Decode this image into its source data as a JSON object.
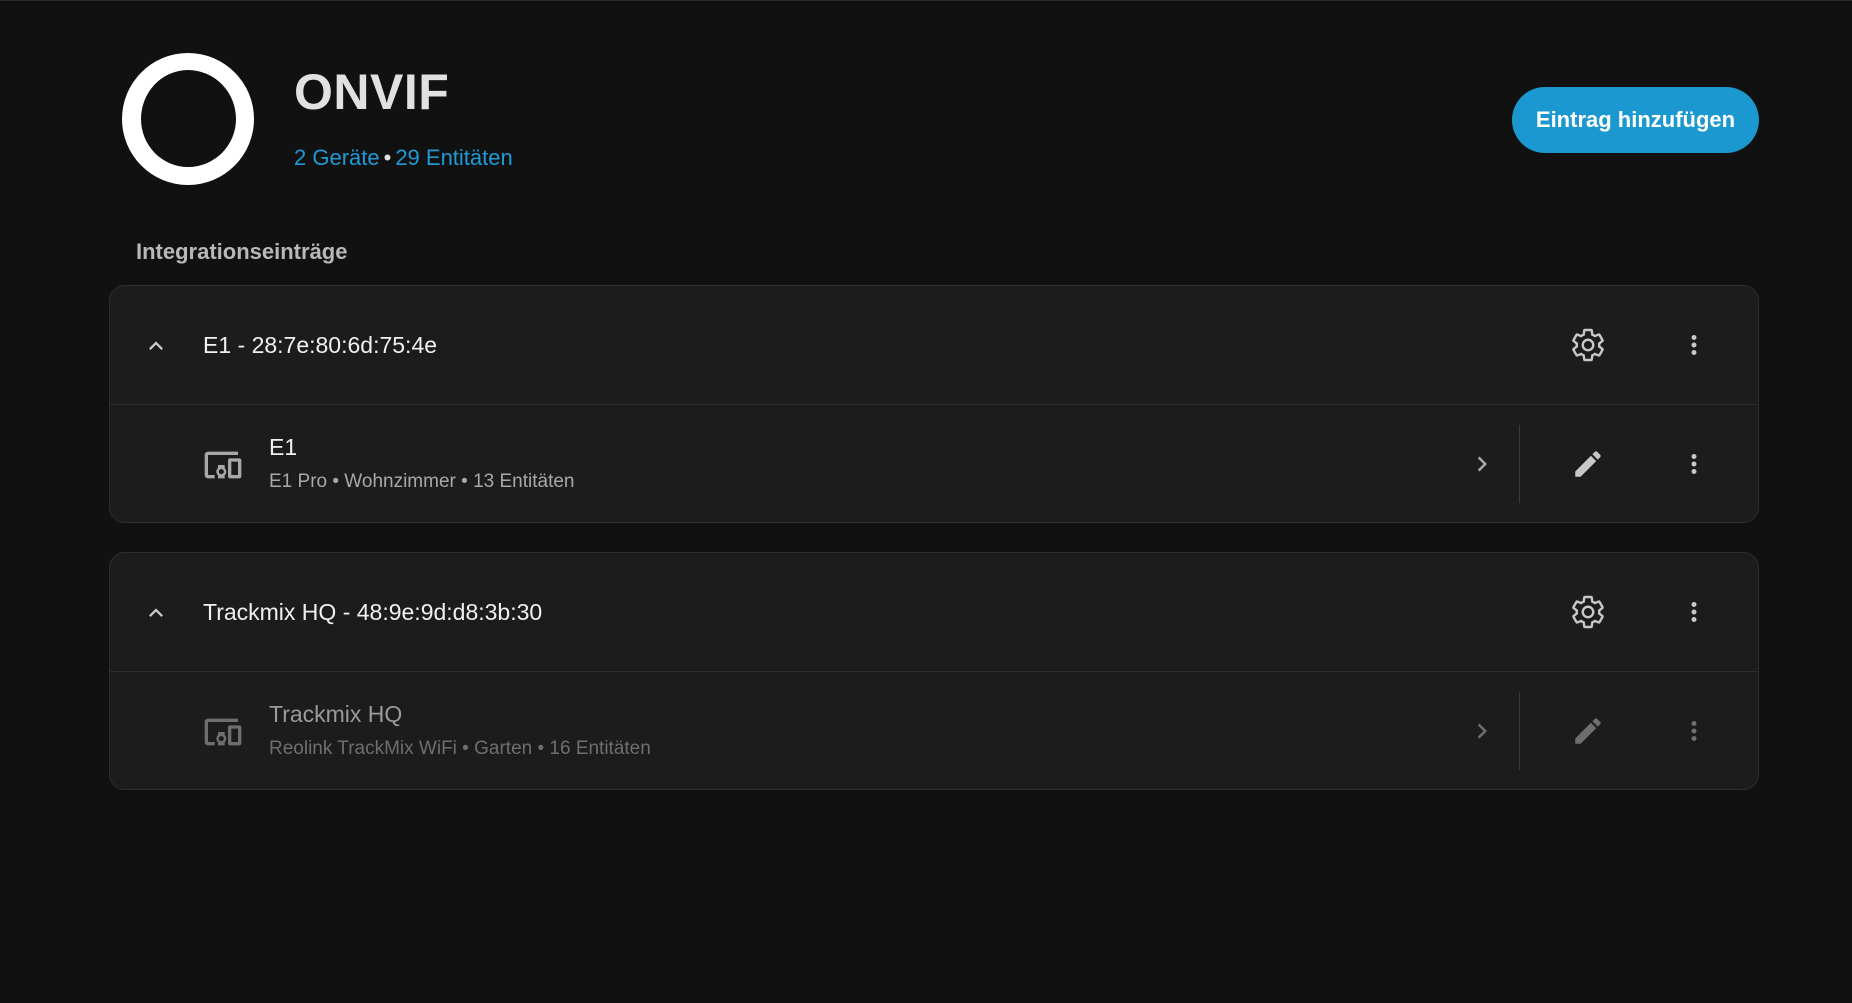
{
  "header": {
    "title": "ONVIF",
    "devices_link": "2 Geräte",
    "separator": "•",
    "entities_link": "29 Entitäten",
    "add_button_label": "Eintrag hinzufügen"
  },
  "section": {
    "label": "Integrationseinträge"
  },
  "entries": [
    {
      "title": "E1 - 28:7e:80:6d:75:4e",
      "device": {
        "name": "E1",
        "meta": "E1 Pro • Wohnzimmer • 13 Entitäten",
        "disabled": false
      }
    },
    {
      "title": "Trackmix HQ - 48:9e:9d:d8:3b:30",
      "device": {
        "name": "Trackmix HQ",
        "meta": "Reolink TrackMix WiFi • Garten • 16 Entitäten",
        "disabled": true
      }
    }
  ],
  "icons": {
    "collapse": "chevron-up-icon",
    "settings": "gear-icon",
    "menu": "dots-vertical-icon",
    "device": "devices-icon",
    "navigate": "chevron-right-icon",
    "edit": "pencil-icon"
  },
  "colors": {
    "background": "#111111",
    "card": "#1c1c1c",
    "accent": "#1a98cf",
    "link": "#1e9bd7"
  }
}
